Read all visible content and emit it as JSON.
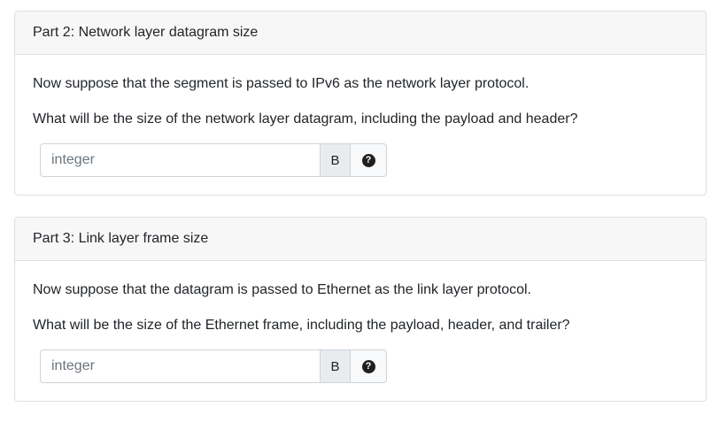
{
  "parts": [
    {
      "header": "Part 2: Network layer datagram size",
      "paragraph1": "Now suppose that the segment is passed to IPv6 as the network layer protocol.",
      "paragraph2": "What will be the size of the network layer datagram, including the payload and header?",
      "input": {
        "placeholder": "integer",
        "value": ""
      },
      "unit": "B",
      "help_icon": "question-circle-icon"
    },
    {
      "header": "Part 3: Link layer frame size",
      "paragraph1": "Now suppose that the datagram is passed to Ethernet as the link layer protocol.",
      "paragraph2": "What will be the size of the Ethernet frame, including the payload, header, and trailer?",
      "input": {
        "placeholder": "integer",
        "value": ""
      },
      "unit": "B",
      "help_icon": "question-circle-icon"
    }
  ],
  "colors": {
    "header_bg": "#f7f7f7",
    "border": "#dfdfdf",
    "unit_bg": "#e9ecef",
    "help_icon": "#1f1f1f"
  }
}
